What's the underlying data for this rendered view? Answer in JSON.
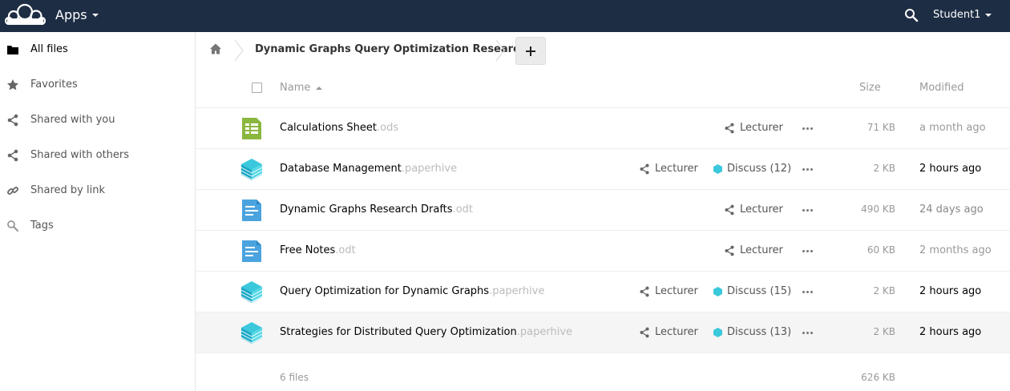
{
  "header": {
    "apps_label": "Apps",
    "user_label": "Student1",
    "bg_color": "#1d2d44"
  },
  "sidebar": {
    "items": [
      {
        "label": "All files",
        "icon": "folder-icon",
        "active": true
      },
      {
        "label": "Favorites",
        "icon": "star-icon"
      },
      {
        "label": "Shared with you",
        "icon": "share-icon"
      },
      {
        "label": "Shared with others",
        "icon": "share-icon"
      },
      {
        "label": "Shared by link",
        "icon": "link-icon"
      },
      {
        "label": "Tags",
        "icon": "tag-icon"
      }
    ]
  },
  "breadcrumb": {
    "home_icon": "home-icon",
    "current": "Dynamic Graphs Query Optimization Research",
    "add_label": "+"
  },
  "table": {
    "headers": {
      "name": "Name",
      "size": "Size",
      "modified": "Modified"
    },
    "rows": [
      {
        "name": "Calculations Sheet",
        "ext": ".ods",
        "icon": "spreadsheet-icon",
        "share": "Lecturer",
        "discuss": null,
        "size": "71 KB",
        "modified": "a month ago",
        "modified_color": "#999999"
      },
      {
        "name": "Database Management",
        "ext": ".paperhive",
        "icon": "paperhive-icon",
        "share": "Lecturer",
        "discuss": "Discuss (12)",
        "size": "2 KB",
        "modified": "2 hours ago",
        "modified_color": "#000000"
      },
      {
        "name": "Dynamic Graphs Research Drafts",
        "ext": ".odt",
        "icon": "document-icon",
        "share": "Lecturer",
        "discuss": null,
        "size": "490 KB",
        "modified": "24 days ago",
        "modified_color": "#888888"
      },
      {
        "name": "Free Notes",
        "ext": ".odt",
        "icon": "document-icon",
        "share": "Lecturer",
        "discuss": null,
        "size": "60 KB",
        "modified": "2 months ago",
        "modified_color": "#999999"
      },
      {
        "name": "Query Optimization for Dynamic Graphs",
        "ext": ".paperhive",
        "icon": "paperhive-icon",
        "share": "Lecturer",
        "discuss": "Discuss (15)",
        "size": "2 KB",
        "modified": "2 hours ago",
        "modified_color": "#000000"
      },
      {
        "name": "Strategies for Distributed Query Optimization",
        "ext": ".paperhive",
        "icon": "paperhive-icon",
        "share": "Lecturer",
        "discuss": "Discuss (13)",
        "size": "2 KB",
        "modified": "2 hours ago",
        "modified_color": "#000000"
      }
    ]
  },
  "summary": {
    "count": "6 files",
    "total_size": "626 KB"
  }
}
